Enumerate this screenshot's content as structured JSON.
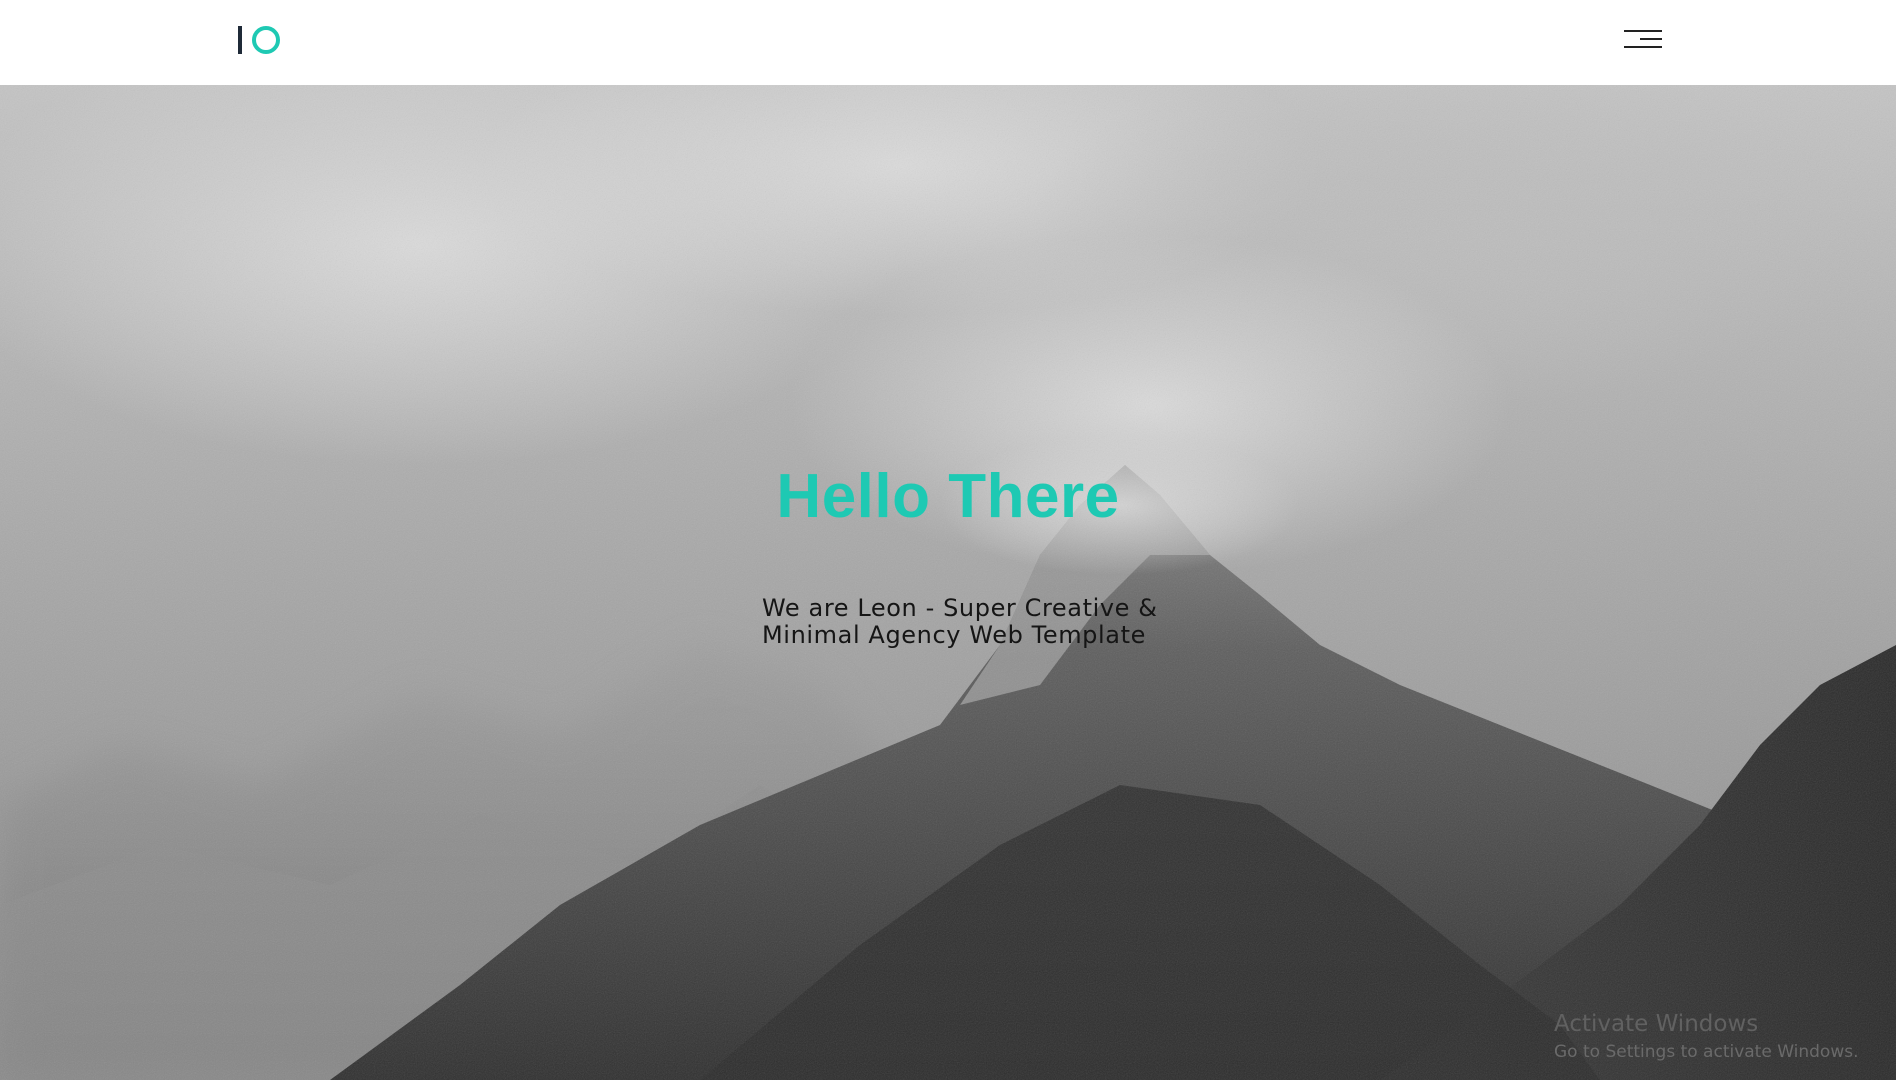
{
  "colors": {
    "accent": "#1ec9b3",
    "logo_bar": "#1f2a38",
    "menu_lines": "#222222",
    "navbar_bg": "#ffffff"
  },
  "header": {
    "logo_icon": "io-logo",
    "menu_icon": "hamburger-menu-icon"
  },
  "hero": {
    "title": "Hello There",
    "subtitle_line1": "We are Leon - Super Creative &",
    "subtitle_line2": "Minimal Agency Web Template",
    "background_icon": "misty-mountain-photo"
  },
  "windows_watermark": {
    "title": "Activate Windows",
    "subtitle": "Go to Settings to activate Windows."
  }
}
